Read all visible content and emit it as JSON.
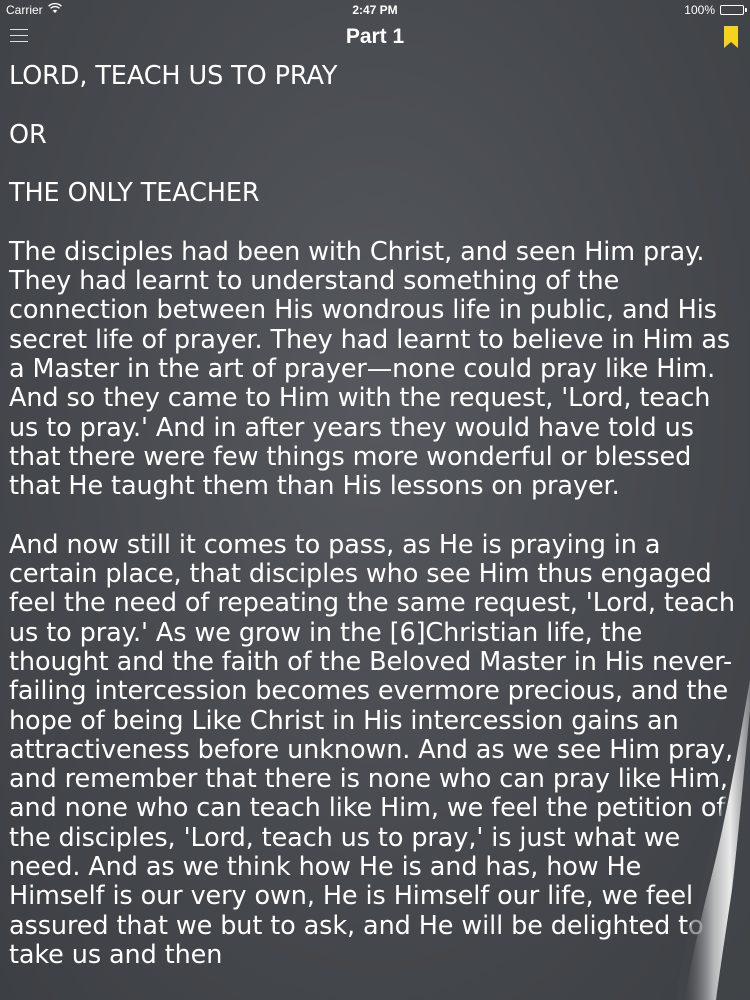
{
  "status_bar": {
    "carrier": "Carrier",
    "time": "2:47 PM",
    "battery": "100%",
    "battery_level": 1.0,
    "wifi_icon": "wifi-icon",
    "battery_icon": "battery-icon"
  },
  "nav": {
    "title": "Part 1",
    "menu_icon": "hamburger-menu-icon",
    "bookmark_icon": "bookmark-icon",
    "bookmark_color": "#f5d21c"
  },
  "content": {
    "heading_1": "LORD, TEACH US TO PRAY",
    "heading_2": "OR",
    "heading_3": "THE ONLY TEACHER",
    "paragraph_1": "The disciples had been with Christ, and seen Him pray. They had learnt to understand something of the connection between His wondrous life in public, and His secret life of prayer. They had learnt to believe in Him as a Master in the art of prayer—none could pray like Him. And so they came to Him with the request, 'Lord, teach us to pray.' And in after years they would have told us that there were few things more wonderful or blessed that He taught them than His lessons on prayer.",
    "paragraph_2": "And now still it comes to pass, as He is praying in a certain place, that disciples who see Him thus engaged feel the need of repeating the same request, 'Lord, teach us to pray.' As we grow in the [6]Christian life, the thought and the faith of the Beloved Master in His never-failing intercession becomes evermore precious, and the hope of being Like Christ in His intercession gains an attractiveness before unknown. And as we see Him pray, and remember that there is none who can pray like Him, and none who can teach like Him, we feel the petition of the disciples, 'Lord, teach us to pray,' is just what we need. And as we think how He is and has, how He Himself is our very own, He is Himself our life, we feel assured that we but to ask, and He will be delighted to take us and then"
  },
  "colors": {
    "background": "#4a4d52",
    "text": "#ffffff"
  },
  "page_curl_icon": "page-curl-icon"
}
